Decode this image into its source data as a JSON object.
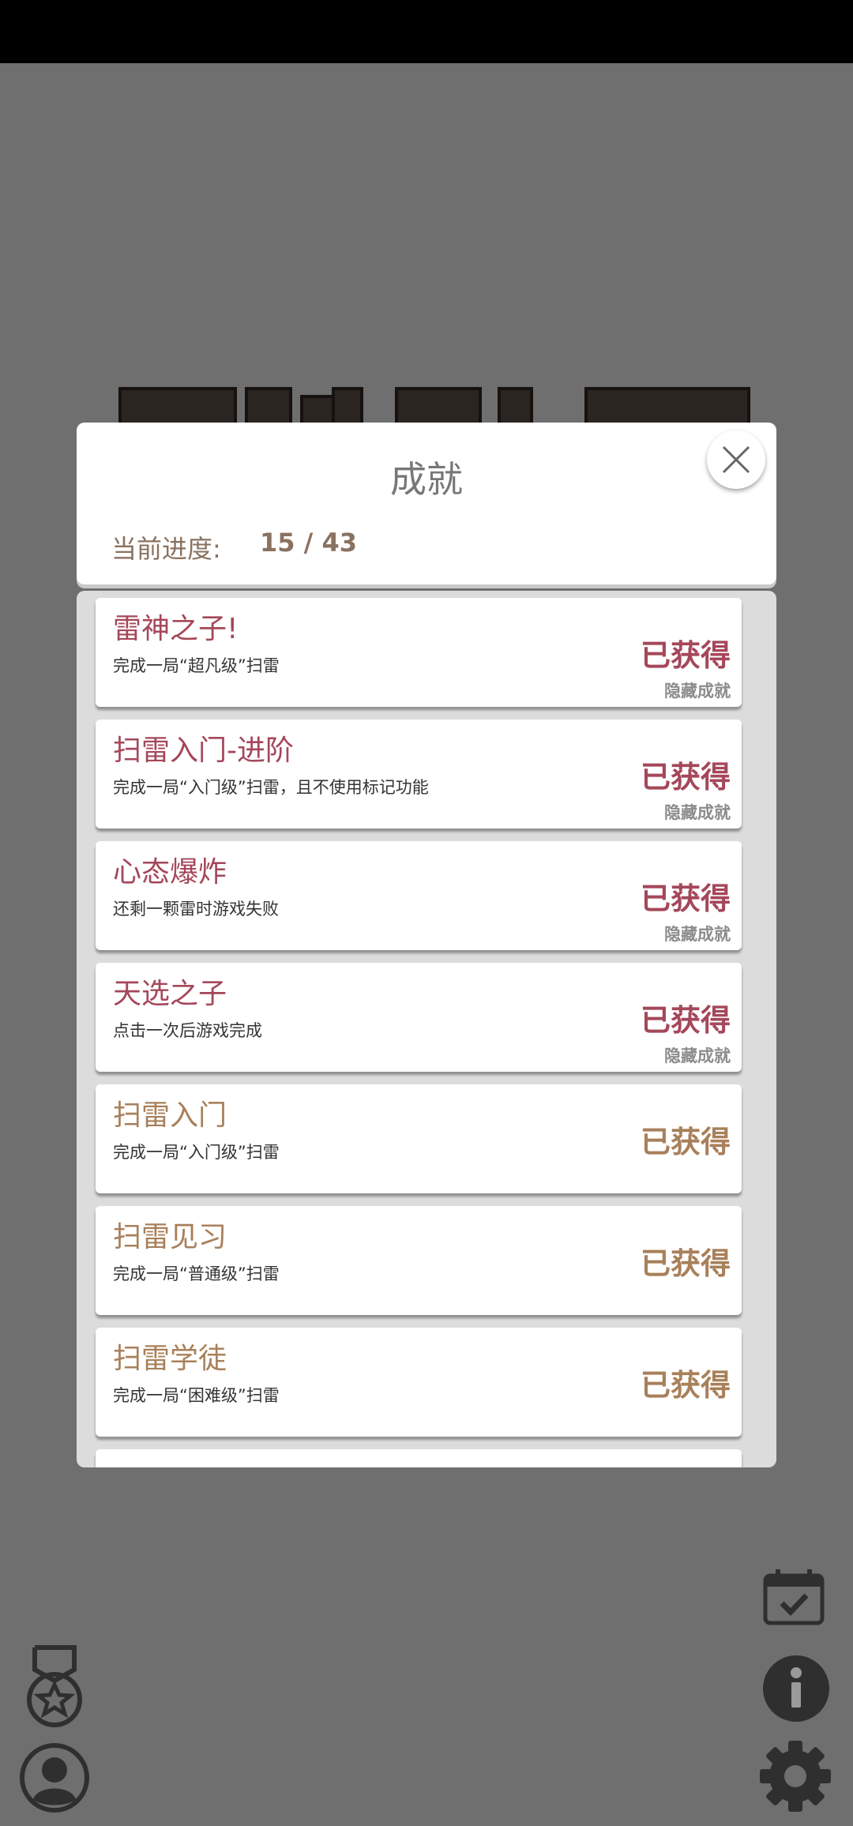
{
  "modal": {
    "title": "成就",
    "progress_label": "当前进度:",
    "progress_value": "15 / 43"
  },
  "achievements": [
    {
      "name": "雷神之子!",
      "desc": "完成一局“超凡级”扫雷",
      "status": "已获得",
      "tag": "隐藏成就"
    },
    {
      "name": "扫雷入门-进阶",
      "desc": "完成一局“入门级”扫雷，且不使用标记功能",
      "status": "已获得",
      "tag": "隐藏成就"
    },
    {
      "name": "心态爆炸",
      "desc": "还剩一颗雷时游戏失败",
      "status": "已获得",
      "tag": "隐藏成就"
    },
    {
      "name": "天选之子",
      "desc": "点击一次后游戏完成",
      "status": "已获得",
      "tag": "隐藏成就"
    },
    {
      "name": "扫雷入门",
      "desc": "完成一局“入门级”扫雷",
      "status": "已获得"
    },
    {
      "name": "扫雷见习",
      "desc": "完成一局“普通级”扫雷",
      "status": "已获得"
    },
    {
      "name": "扫雷学徒",
      "desc": "完成一局“困难级”扫雷",
      "status": "已获得"
    }
  ],
  "icons": {
    "close": "close-icon",
    "calendar": "calendar-check-icon",
    "info": "info-icon",
    "settings": "gear-icon",
    "achievements": "medal-icon",
    "profile": "user-icon"
  },
  "colors": {
    "hidden_accent": "#a5475a",
    "normal_accent": "#a8805a",
    "overlay": "#6f6f6f"
  }
}
